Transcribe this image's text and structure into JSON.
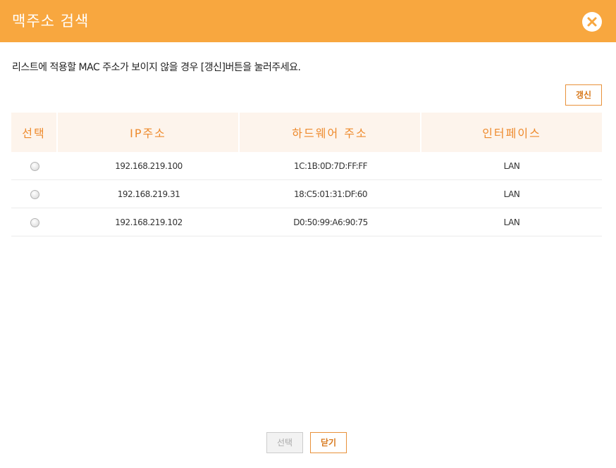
{
  "header": {
    "title": "맥주소 검색",
    "close_icon": "close-icon"
  },
  "notice": "리스트에 적용할 MAC 주소가 보이지 않을 경우 [갱신]버튼을 눌러주세요.",
  "refresh_label": "갱신",
  "table": {
    "headers": [
      "선택",
      "IP주소",
      "하드웨어 주소",
      "인터페이스"
    ],
    "rows": [
      {
        "ip": "192.168.219.100",
        "mac": "1C:1B:0D:7D:FF:FF",
        "iface": "LAN"
      },
      {
        "ip": "192.168.219.31",
        "mac": "18:C5:01:31:DF:60",
        "iface": "LAN"
      },
      {
        "ip": "192.168.219.102",
        "mac": "D0:50:99:A6:90:75",
        "iface": "LAN"
      }
    ]
  },
  "footer": {
    "select_label": "선택",
    "close_label": "닫기"
  },
  "colors": {
    "accent": "#f8a73f",
    "header_text": "#ee8a2c",
    "button_text": "#d87a1e"
  }
}
